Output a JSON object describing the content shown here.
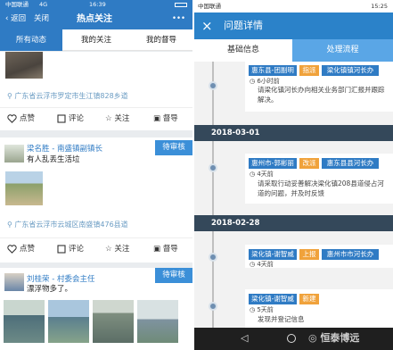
{
  "left": {
    "status": {
      "carrier": "中国联通",
      "net": "4G",
      "time": "16:39"
    },
    "header": {
      "back": "返回",
      "close": "关闭",
      "title": "热点关注",
      "more": "•••"
    },
    "tabs": [
      "所有动态",
      "我的关注",
      "我的督导"
    ],
    "posts": [
      {
        "location": "广东省云浮市罗定市生江镇828乡道"
      },
      {
        "name": "梁名胜 - 南盛镇副镇长",
        "badge": "待审核",
        "text": "有人乱丢生活垃",
        "location": "广东省云浮市云城区南盛镇476县道"
      },
      {
        "name": "刘桂荣 - 村委会主任",
        "badge": "待审核",
        "text": "漂浮物多了。"
      }
    ],
    "actions": [
      "点赞",
      "评论",
      "关注",
      "督导"
    ]
  },
  "right": {
    "status": {
      "carrier": "中国联通",
      "time": "15:25"
    },
    "header": {
      "close": "×",
      "title": "问题详情"
    },
    "tabs": [
      "基础信息",
      "处理流程"
    ],
    "dates": [
      "2018-03-01",
      "2018-02-28"
    ],
    "entries": [
      {
        "tags": [
          "惠东县-团副明",
          "指派",
          "梁化镇镇河长办"
        ],
        "time": "6小时前",
        "body": "请梁化镇河长办向相关业务部门汇报并跟踪解决。"
      },
      {
        "tags": [
          "惠州市-郭彬丽",
          "改派",
          "惠东县县河长办"
        ],
        "time": "4天前",
        "body": "请采取行动妥善解决梁化镇208县道侵占河道的问题，并及时反馈"
      },
      {
        "tags": [
          "梁化镇-谢智威",
          "上报",
          "惠州市市河长办"
        ],
        "time": "4天前",
        "body": ""
      },
      {
        "tags": [
          "梁化镇-谢智威",
          "新建"
        ],
        "time": "5天前",
        "body": "发现并登记信息"
      }
    ],
    "watermark": "恒泰博远"
  },
  "colors": {
    "primary": "#2f7bc4",
    "orange": "#f0a23b",
    "dark": "#34485a"
  }
}
